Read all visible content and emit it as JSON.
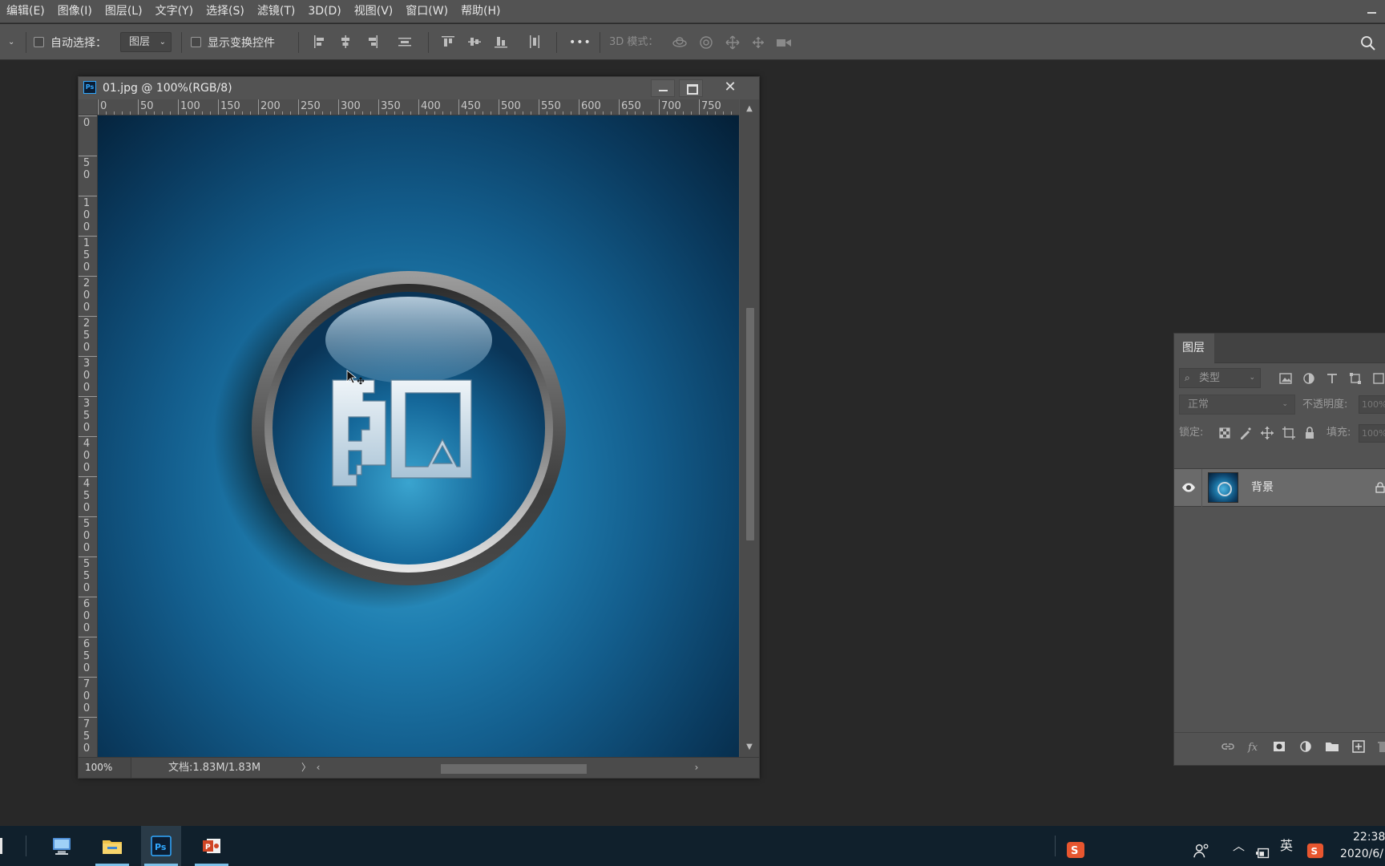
{
  "menubar": {
    "items": [
      "编辑(E)",
      "图像(I)",
      "图层(L)",
      "文字(Y)",
      "选择(S)",
      "滤镜(T)",
      "3D(D)",
      "视图(V)",
      "窗口(W)",
      "帮助(H)"
    ]
  },
  "options_bar": {
    "auto_select_label": "自动选择：",
    "auto_select_checked": false,
    "auto_select_target": "图层",
    "show_transform_label": "显示变换控件",
    "show_transform_checked": false,
    "more_label": "•••",
    "mode_3d_label": "3D 模式：",
    "align_icons": [
      "align-left-edges-icon",
      "align-horizontal-centers-icon",
      "align-right-edges-icon",
      "distribute-horizontal-icon",
      "align-top-edges-icon",
      "align-vertical-centers-icon",
      "align-bottom-edges-icon",
      "distribute-vertical-icon"
    ],
    "mode_3d_icons": [
      "orbit-3d-icon",
      "roll-3d-icon",
      "pan-3d-icon",
      "slide-3d-icon",
      "scale-3d-icon"
    ],
    "search_icon": "search-icon"
  },
  "document": {
    "title": "01.jpg @ 100%(RGB/8)",
    "ruler_h_labels": [
      "0",
      "50",
      "100",
      "150",
      "200",
      "250",
      "300",
      "350",
      "400",
      "450",
      "500",
      "550",
      "600",
      "650",
      "700",
      "750"
    ],
    "ruler_v_labels": [
      "0",
      "50",
      "100",
      "150",
      "200",
      "250",
      "300",
      "350",
      "400",
      "450",
      "500",
      "550",
      "600",
      "650",
      "700",
      "750"
    ],
    "zoom": "100%",
    "doc_info": "文档:1.83M/1.83M",
    "status_arrow": "〉",
    "close_glyph": "✕"
  },
  "layers_panel": {
    "tab_label": "图层",
    "filter_placeholder": "类型",
    "blend_mode": "正常",
    "opacity_label": "不透明度:",
    "opacity_value": "100%",
    "lock_label": "锁定:",
    "fill_label": "填充:",
    "fill_value": "100%",
    "layers": [
      {
        "name": "背景",
        "visible": true,
        "locked": true
      }
    ]
  },
  "taskbar": {
    "apps": [
      {
        "name": "computer-icon",
        "active": false
      },
      {
        "name": "file-explorer-icon",
        "active": false
      },
      {
        "name": "photoshop-icon",
        "active": true
      },
      {
        "name": "powerpoint-icon",
        "active": false
      }
    ],
    "tray_lang": "英",
    "clock_time": "22:38",
    "clock_date": "2020/6/"
  },
  "colors": {
    "app_bg": "#282828",
    "panel_bg": "#535353",
    "accent": "#31a8ff",
    "taskbar_bg": "#10202c"
  }
}
